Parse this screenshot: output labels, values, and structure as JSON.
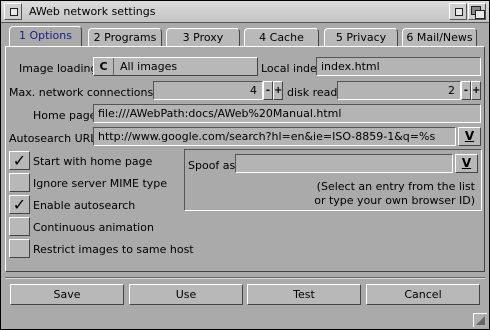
{
  "window": {
    "title": "AWeb network settings"
  },
  "tabs": [
    {
      "label": "1 Options",
      "active": true
    },
    {
      "label": "2 Programs"
    },
    {
      "label": "3 Proxy"
    },
    {
      "label": "4 Cache"
    },
    {
      "label": "5 Privacy"
    },
    {
      "label": "6 Mail/News"
    }
  ],
  "options": {
    "image_loading_label": "Image loading",
    "image_loading_value": "All images",
    "local_index_label": "Local index",
    "local_index_value": "index.html",
    "max_connections_label": "Max. network connections",
    "max_connections_value": "4",
    "disk_reads_label": "disk reads",
    "disk_reads_value": "2",
    "plus": "+",
    "minus": "-",
    "home_page_label": "Home page",
    "home_page_value": "file:///AWebPath:docs/AWeb%20Manual.html",
    "autosearch_label": "Autosearch URL",
    "autosearch_value": "http://www.google.com/search?hl=en&ie=ISO-8859-1&q=%s",
    "popup_glyph": "V",
    "cycle_glyph": "C",
    "checkmark": "✓",
    "checks": [
      {
        "label": "Start with home page",
        "checked": true
      },
      {
        "label": "Ignore server MIME type",
        "checked": false
      },
      {
        "label": "Enable autosearch",
        "checked": true
      },
      {
        "label": "Continuous animation",
        "checked": false
      },
      {
        "label": "Restrict images to same host",
        "checked": false
      }
    ],
    "spoof_label": "Spoof as",
    "spoof_value": "",
    "spoof_hint_1": "(Select an entry from the list",
    "spoof_hint_2": "or type your own browser ID)"
  },
  "buttons": {
    "save": "Save",
    "use": "Use",
    "test": "Test",
    "cancel": "Cancel"
  }
}
